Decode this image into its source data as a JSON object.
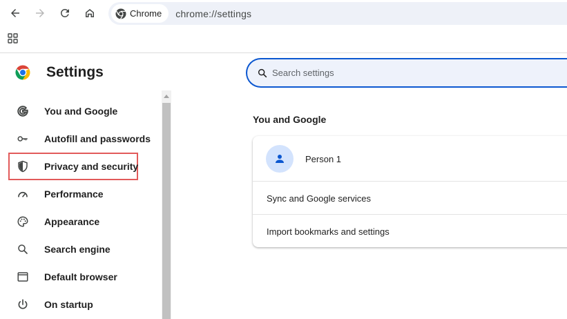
{
  "toolbar": {
    "chip_label": "Chrome",
    "url": "chrome://settings",
    "icons": [
      "back-arrow-icon",
      "forward-arrow-icon",
      "reload-icon",
      "home-icon",
      "chrome-logo-icon"
    ]
  },
  "bookmarks_bar": {
    "icons": [
      "apps-grid-icon"
    ]
  },
  "settings": {
    "title": "Settings",
    "search_placeholder": "Search settings"
  },
  "sidebar": {
    "items": [
      {
        "label": "You and Google",
        "icon": "google-g-icon"
      },
      {
        "label": "Autofill and passwords",
        "icon": "key-icon"
      },
      {
        "label": "Privacy and security",
        "icon": "shield-icon",
        "highlighted": true
      },
      {
        "label": "Performance",
        "icon": "speedometer-icon"
      },
      {
        "label": "Appearance",
        "icon": "palette-icon"
      },
      {
        "label": "Search engine",
        "icon": "search-icon"
      },
      {
        "label": "Default browser",
        "icon": "browser-window-icon"
      },
      {
        "label": "On startup",
        "icon": "power-icon"
      }
    ]
  },
  "main": {
    "section_title": "You and Google",
    "profile_name": "Person 1",
    "rows": [
      "Sync and Google services",
      "Import bookmarks and settings"
    ]
  },
  "colors": {
    "accent": "#0b57d0",
    "highlight_border": "#e25a5a",
    "omnibox_bg": "#eef1f8",
    "avatar_bg": "#d3e3fd"
  }
}
